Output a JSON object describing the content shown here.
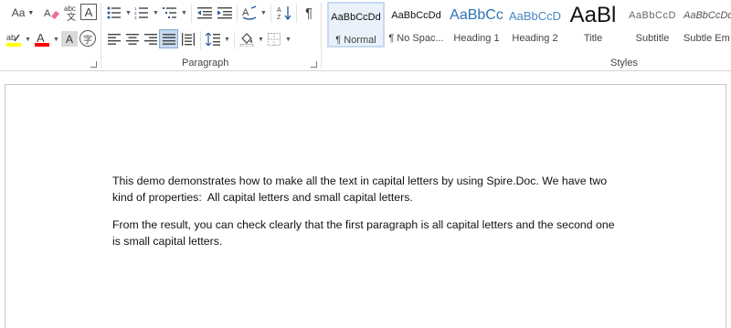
{
  "ribbon": {
    "font_group": {
      "change_case_label": "Aa",
      "clear_formatting_title": "Clear All Formatting",
      "phonetic_guide_label": "abc",
      "character_border_label": "A",
      "highlight_label": "ab",
      "font_color_label": "A",
      "character_shading_label": "A",
      "enclose_label": "字"
    },
    "paragraph_group": {
      "label": "Paragraph"
    },
    "styles_group": {
      "label": "Styles",
      "items": [
        {
          "preview": "AaBbCcDd",
          "name": "¶ Normal"
        },
        {
          "preview": "AaBbCcDd",
          "name": "¶ No Spac..."
        },
        {
          "preview": "AaBbCc",
          "name": "Heading 1"
        },
        {
          "preview": "AaBbCcD",
          "name": "Heading 2"
        },
        {
          "preview": "AaBl",
          "name": "Title"
        },
        {
          "preview": "AaBbCcD",
          "name": "Subtitle"
        },
        {
          "preview": "AaBbCcDd",
          "name": "Subtle Em"
        }
      ]
    },
    "colors": {
      "highlight": "#ffff00",
      "font_color": "#ff0000",
      "heading_blue": "#2e74b5",
      "heading2_blue": "#4a86c5"
    }
  },
  "document": {
    "paragraphs": [
      {
        "line1": "This demo demonstrates how to make all the text in capital letters by using Spire.Doc. We have two",
        "line2": "kind of properties:  All capital letters and small capital letters."
      },
      {
        "line1": "From the result, you can check clearly that the first paragraph is all capital letters and the second one",
        "line2": "is small capital letters."
      }
    ]
  }
}
